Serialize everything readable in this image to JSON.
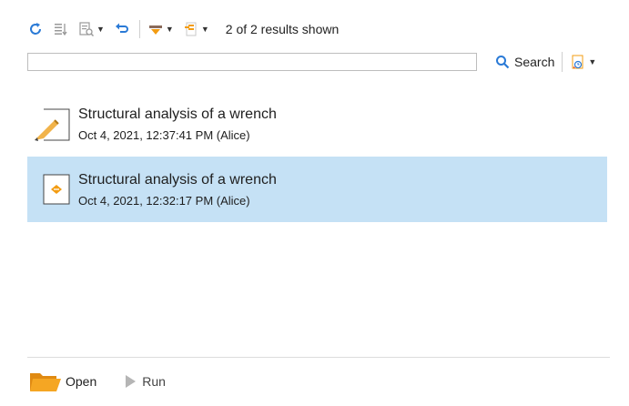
{
  "toolbar": {
    "results_text": "2 of 2 results shown",
    "icons": [
      "refresh-icon",
      "sort-icon",
      "filter-icon",
      "undo-icon",
      "insert-icon",
      "list-options-icon"
    ]
  },
  "search": {
    "value": "",
    "button_label": "Search"
  },
  "items": [
    {
      "title": "Structural analysis of a wrench",
      "subtitle": "Oct 4, 2021, 12:37:41 PM (Alice)",
      "selected": false
    },
    {
      "title": "Structural analysis of a wrench",
      "subtitle": "Oct 4, 2021, 12:32:17 PM (Alice)",
      "selected": true
    }
  ],
  "bottom": {
    "open_label": "Open",
    "run_label": "Run"
  },
  "colors": {
    "accent_blue": "#2a7ad6",
    "accent_orange": "#f39c12",
    "selection": "#c5e1f5"
  }
}
